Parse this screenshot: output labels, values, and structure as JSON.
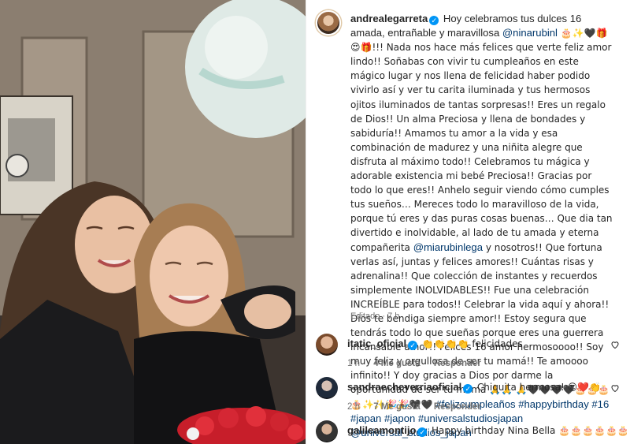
{
  "post": {
    "username": "andrealegarreta",
    "caption_p1": "Hoy celebramos tus dulces 16 amada, entrañable y maravillosa ",
    "mention1": "@ninarubinl",
    "caption_p2": " 🎂✨🖤🎁😍🎁!!! Nada nos hace más felices que verte feliz amor lindo!! Soñabas con vivir tu cumpleaños en este mágico lugar y nos llena de felicidad haber podido vivirlo así y ver tu carita iluminada y tus hermosos ojitos iluminados de tantas sorpresas!! Eres un regalo de Dios!! Un alma Preciosa y llena de bondades y sabiduría!! Amamos tu amor a la vida y esa combinación de madurez y una niñita alegre que disfruta al máximo todo!! Celebramos tu mágica y adorable existencia mi bebé Preciosa!! Gracias por todo lo que eres!! Anhelo seguir viendo cómo cumples tus sueños… Mereces todo lo maravilloso de la vida, porque tú eres y das puras cosas buenas… Que dia tan divertido e inolvidable, al lado de tu amada y eterna compañerita ",
    "mention2": "@miarubinlega",
    "caption_p3": " y nosotros!! Que fortuna verlas así, juntas y felices amores!! Cuántas risas y adrenalina!! Que colección de instantes y recuerdos simplemente INOLVIDABLES!! Fue una celebración INCREÍBLE para todos!! Celebrar la vida aquí y ahora!! Dios te bendiga siempre amor!! Estoy segura que tendrás todo lo que sueñas porque eres una guerrera incansable amor!! Felices 16 amor hermosoooo!! Soy muy feliz y orgullosa de ser tu mamá!! Te amoooo infinito!! Y doy gracias a Dios por darme la oportunidad de ser tu mamá 🙏🙏 🙏🖤🖤🖤🖤🎂🎂🎂🎂✨✨🎉🎉🖤🖤 ",
    "hashtags": "#felizcumpleaños #happybirthday #16 #japan #japon #universalstudiosjapan @universal_studios_japan",
    "edited": "Editado · 7 h"
  },
  "comments": [
    {
      "username": "itatic_oficial",
      "text": "👏👏👏👏 felicidades",
      "time": "1 h",
      "likes": "4 Me gusta",
      "reply": "Responder"
    },
    {
      "username": "sandraecheverriaoficial",
      "text": "Chiquita hermosa! 😍❤️👏",
      "time": "2 h",
      "likes": "7 Me gusta",
      "reply": "Responder"
    },
    {
      "username": "galileamontijo",
      "text": "Happy birthday Nina Bella 🎂🎂🎂🎂🎂🎂🎂",
      "time": "",
      "likes": "",
      "reply": ""
    }
  ],
  "icons": {
    "verified": "verified-badge-icon",
    "like": "heart-icon"
  },
  "colors": {
    "link": "#00376b",
    "verified": "#0095f6",
    "muted": "#737373"
  }
}
